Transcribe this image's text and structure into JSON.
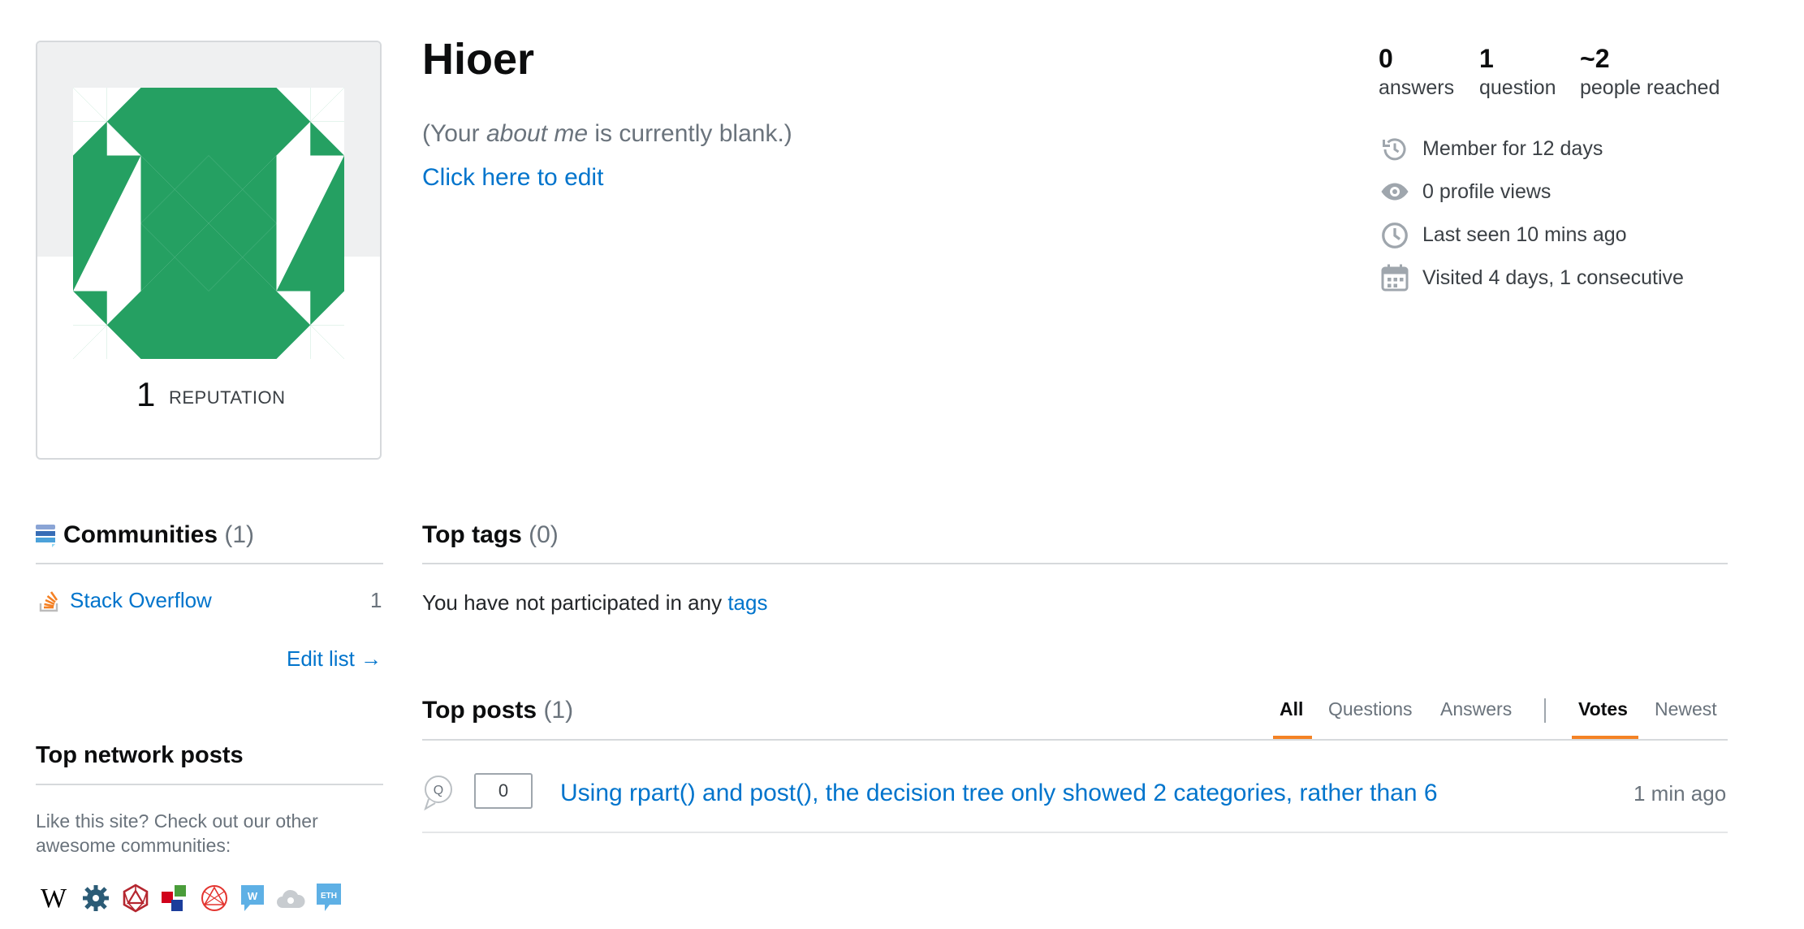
{
  "profile": {
    "name": "Hioer",
    "reputation": "1",
    "reputation_label": "REPUTATION",
    "about_prefix": "(Your ",
    "about_em": "about me",
    "about_suffix": " is currently blank.)",
    "edit_link": "Click here to edit"
  },
  "stats": [
    {
      "value": "0",
      "label": "answers"
    },
    {
      "value": "1",
      "label": "question"
    },
    {
      "value": "~2",
      "label": "people reached"
    }
  ],
  "info": [
    {
      "icon": "history-icon",
      "text": "Member for 12 days"
    },
    {
      "icon": "eye-icon",
      "text": "0 profile views"
    },
    {
      "icon": "clock-icon",
      "text": "Last seen 10 mins ago"
    },
    {
      "icon": "calendar-icon",
      "text": "Visited 4 days, 1 consecutive"
    }
  ],
  "communities": {
    "title": "Communities",
    "count": "(1)",
    "items": [
      {
        "name": "Stack Overflow",
        "reputation": "1"
      }
    ],
    "edit_link": "Edit list →"
  },
  "network": {
    "title": "Top network posts",
    "text": "Like this site? Check out our other awesome communities:",
    "icons": [
      "wikipedia-icon",
      "gear-network-icon",
      "d20-icon",
      "blocks-icon",
      "geometry-icon",
      "w-bubble-icon",
      "cloud-icon",
      "eth-icon"
    ]
  },
  "top_tags": {
    "title": "Top tags",
    "count": "(0)",
    "empty_text": "You have not participated in any ",
    "empty_link": "tags"
  },
  "top_posts": {
    "title": "Top posts",
    "count": "(1)",
    "filters": [
      "All",
      "Questions",
      "Answers"
    ],
    "sort": [
      "Votes",
      "Newest"
    ],
    "posts": [
      {
        "score": "0",
        "title": "Using rpart() and post(), the decision tree only showed 2 categories, rather than 6",
        "time": "1 min ago"
      }
    ]
  },
  "colors": {
    "accent": "#f48225",
    "link": "#0074cc",
    "avatar_green": "#25a062"
  }
}
